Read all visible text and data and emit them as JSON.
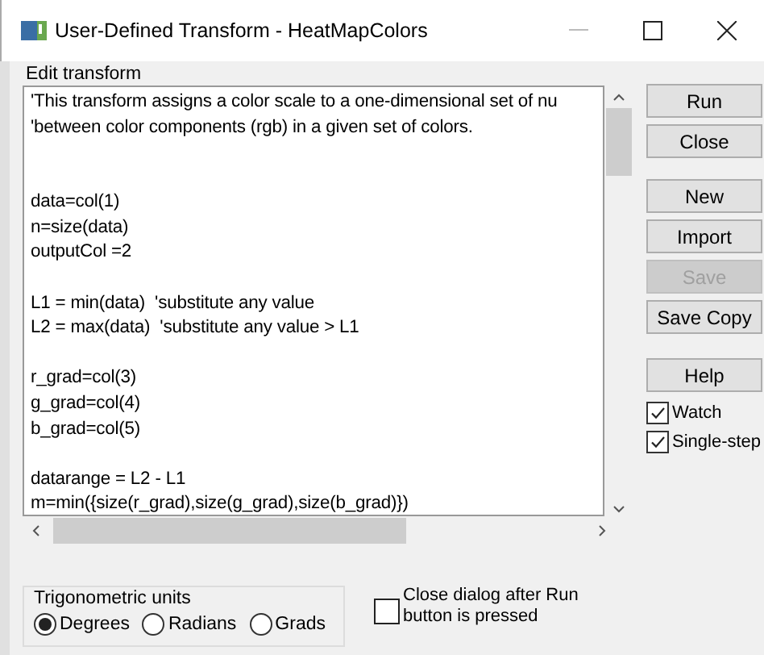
{
  "window": {
    "title": "User-Defined Transform - HeatMapColors"
  },
  "editor": {
    "label": "Edit transform",
    "code_blocks": [
      [
        "'This transform assigns a color scale to a one-dimensional set of nu",
        "'between color components (rgb) in a given set of colors."
      ],
      [
        "data=col(1)",
        "n=size(data)",
        "outputCol =2"
      ],
      [
        "L1 = min(data)  'substitute any value",
        "L2 = max(data)  'substitute any value > L1"
      ],
      [
        "r_grad=col(3)",
        "g_grad=col(4)",
        "b_grad=col(5)"
      ],
      [
        "datarange = L2 - L1",
        "m=min({size(r_grad),size(g_grad),size(b_grad)})"
      ]
    ]
  },
  "buttons": [
    {
      "label": "Run",
      "disabled": false
    },
    {
      "label": "Close",
      "disabled": false
    },
    {
      "label": "New",
      "disabled": false
    },
    {
      "label": "Import",
      "disabled": false
    },
    {
      "label": "Save",
      "disabled": true
    },
    {
      "label": "Save Copy",
      "disabled": false
    },
    {
      "label": "Help",
      "disabled": false
    }
  ],
  "options": [
    {
      "label": "Watch",
      "checked": true
    },
    {
      "label": "Single-step",
      "checked": true
    }
  ],
  "trig_units": {
    "label": "Trigonometric units",
    "choices": [
      {
        "label": "Degrees",
        "selected": true
      },
      {
        "label": "Radians",
        "selected": false
      },
      {
        "label": "Grads",
        "selected": false
      }
    ]
  },
  "close_after_run": {
    "label": "Close dialog after Run button is pressed",
    "checked": false
  }
}
